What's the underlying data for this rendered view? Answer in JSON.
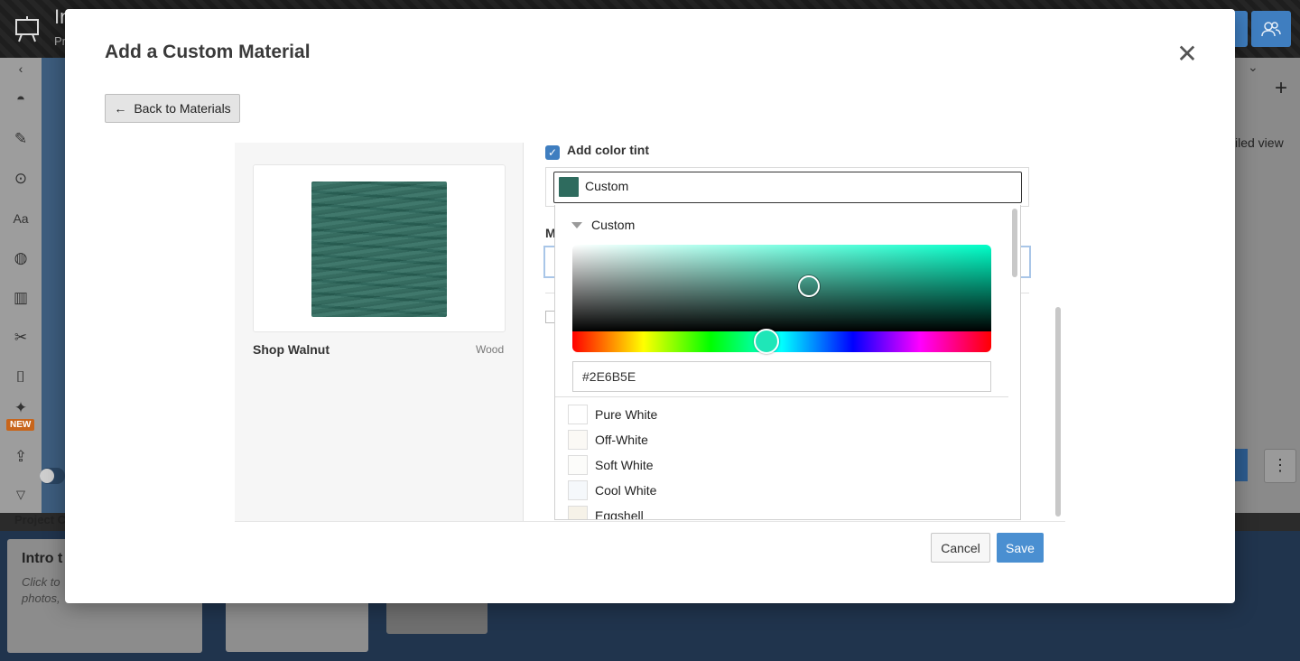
{
  "app": {
    "title_fragment": "In",
    "subtitle_fragment": "Pr",
    "right_view_label": "iled view",
    "project_label": "Project C",
    "card_title": "Intro t",
    "card_text_1": "Click to",
    "card_text_2": "photos,",
    "sidebar_new_badge": "NEW",
    "sidebar_text_icon": "Aa"
  },
  "modal": {
    "title": "Add a Custom Material",
    "back_button": "Back to Materials",
    "close_glyph": "✕"
  },
  "material": {
    "name": "Shop Walnut",
    "type": "Wood",
    "tint_color": "#2E6B5E"
  },
  "tint": {
    "checkbox_label": "Add color tint",
    "checked": true,
    "selected": "Custom",
    "hidden_label_fragment": "M"
  },
  "picker": {
    "group_label": "Custom",
    "hex_value": "#2E6B5E",
    "swatches": [
      {
        "name": "Pure White",
        "color": "#FFFFFF"
      },
      {
        "name": "Off-White",
        "color": "#FBF9F5"
      },
      {
        "name": "Soft White",
        "color": "#FCFCFA"
      },
      {
        "name": "Cool White",
        "color": "#F5F8FB"
      },
      {
        "name": "Eggshell",
        "color": "#F6F2E8"
      }
    ]
  },
  "footer": {
    "cancel": "Cancel",
    "save": "Save"
  },
  "colors": {
    "accent": "#4A8FD1",
    "checkbox": "#3F7EC0"
  }
}
